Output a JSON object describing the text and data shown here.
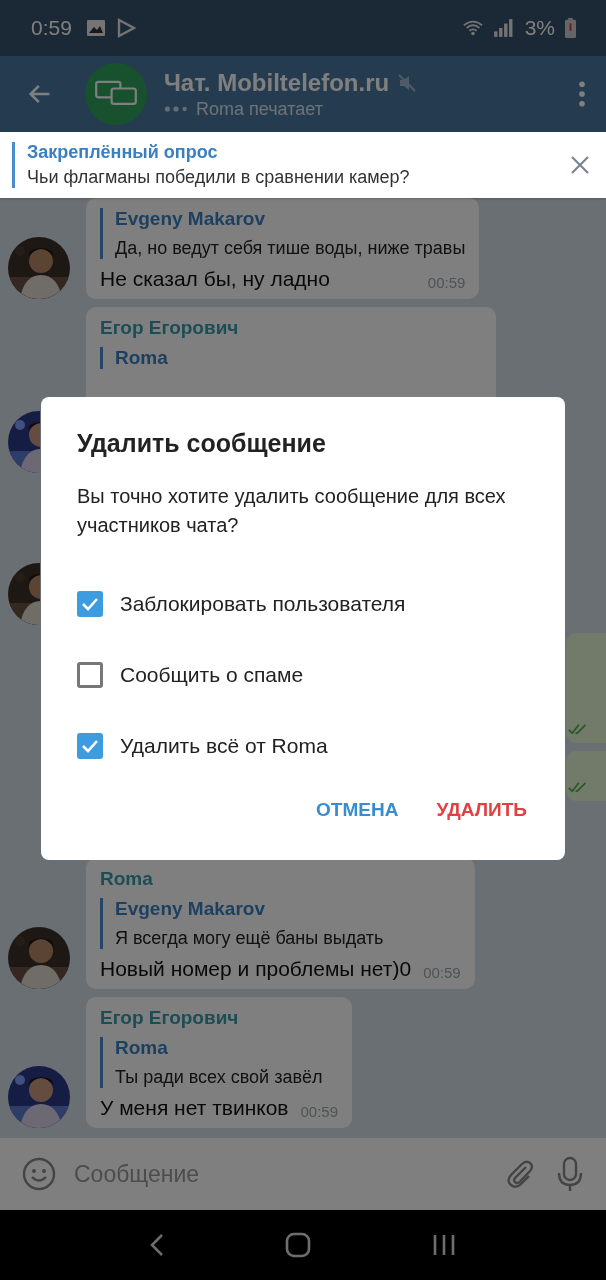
{
  "status_bar": {
    "time": "0:59",
    "battery": "3%"
  },
  "header": {
    "title": "Чат. Mobiltelefon.ru",
    "muted": true,
    "status": "Roma печатает"
  },
  "pinned": {
    "label": "Закреплённый опрос",
    "text": "Чьи флагманы победили в сравнении камер?"
  },
  "messages": [
    {
      "reply": {
        "author": "Evgeny Makarov",
        "text": "Да, но ведут себя тише воды, ниже травы"
      },
      "text": "Не сказал бы, ну ладно",
      "time": "00:59"
    },
    {
      "sender": "Егор Егорович",
      "reply": {
        "author": "Roma"
      }
    },
    {
      "sender": "Roma",
      "reply": {
        "author": "Evgeny Makarov",
        "text": "Я всегда могу ещё баны выдать"
      },
      "text": "Новый номер и проблемы нет)0",
      "time": "00:59"
    },
    {
      "sender": "Егор Егорович",
      "reply": {
        "author": "Roma",
        "text": "Ты ради всех свой завёл"
      },
      "text": "У меня нет твинков",
      "time": "00:59"
    }
  ],
  "composer": {
    "placeholder": "Сообщение"
  },
  "dialog": {
    "title": "Удалить сообщение",
    "text": "Вы точно хотите удалить сообщение для всех участников чата?",
    "options": [
      {
        "label": "Заблокировать пользователя",
        "checked": true
      },
      {
        "label": "Сообщить о спаме",
        "checked": false
      },
      {
        "label": "Удалить всё от Roma",
        "checked": true
      }
    ],
    "buttons": [
      {
        "label": "ОТМЕНА",
        "kind": "cancel"
      },
      {
        "label": "УДАЛИТЬ",
        "kind": "destructive"
      }
    ]
  }
}
